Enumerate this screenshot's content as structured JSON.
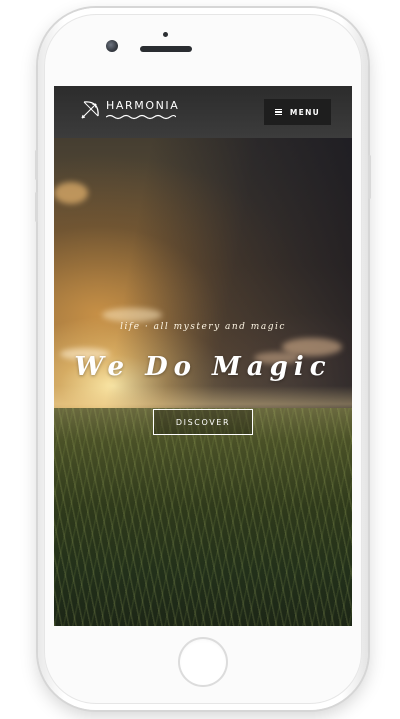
{
  "app": {
    "brand_name": "HARMONIA",
    "menu_label": "MENU"
  },
  "hero": {
    "tagline": "life · all mystery and magic",
    "headline": "We Do Magic",
    "cta_label": "DISCOVER"
  },
  "icons": {
    "logo": "bow-and-arrow-icon",
    "menu": "hamburger-icon"
  },
  "colors": {
    "navbar": "#333333",
    "menu_button": "#1e1e1e",
    "text": "#ffffff",
    "device_frame": "#ffffff"
  }
}
